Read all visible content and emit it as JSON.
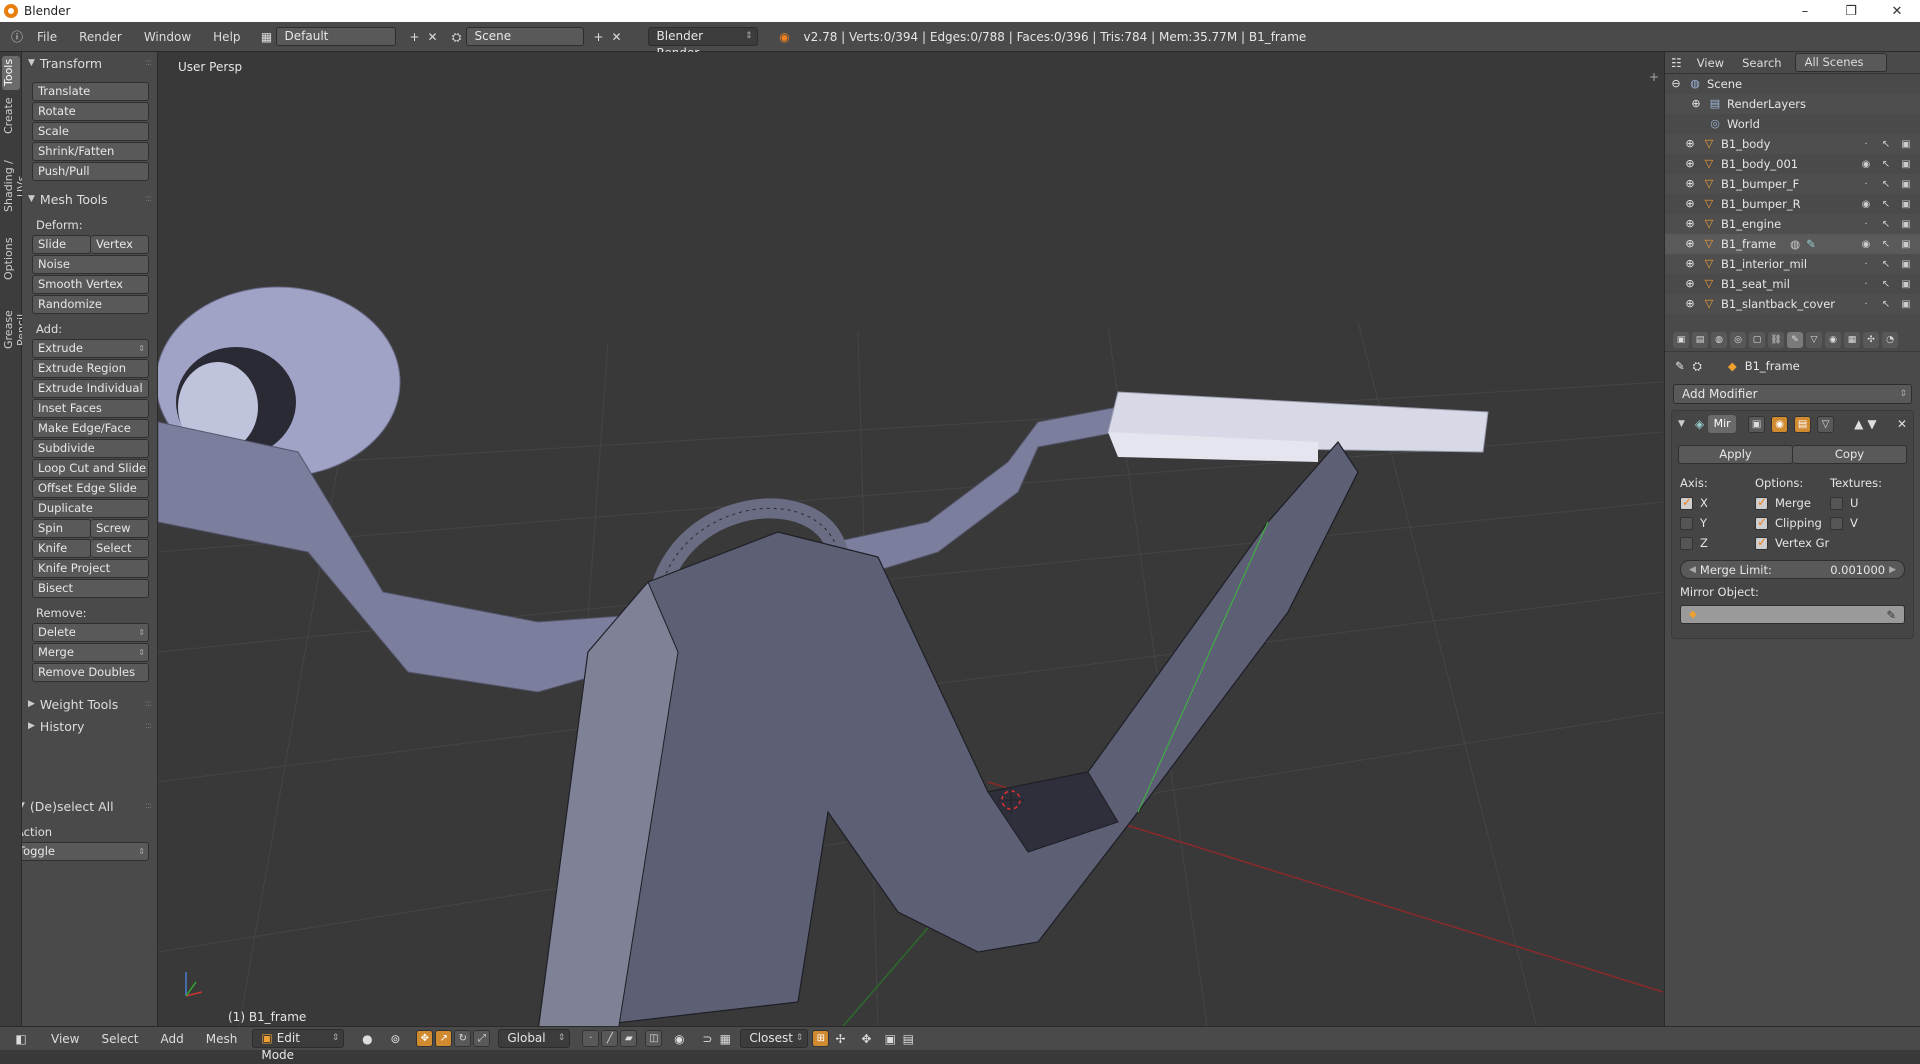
{
  "window": {
    "title": "Blender",
    "controls": [
      "–",
      "❐",
      "✕"
    ]
  },
  "infobar": {
    "menus": [
      "File",
      "Render",
      "Window",
      "Help"
    ],
    "layout": "Default",
    "scene": "Scene",
    "engine": "Blender Render",
    "stats": "v2.78 | Verts:0/394 | Edges:0/788 | Faces:0/396 | Tris:784 | Mem:35.77M | B1_frame"
  },
  "tabs": [
    "Tools",
    "Create",
    "Shading / UVs",
    "Options",
    "Grease Pencil"
  ],
  "toolshelf": {
    "transform": {
      "title": "Transform",
      "buttons": [
        "Translate",
        "Rotate",
        "Scale",
        "Shrink/Fatten",
        "Push/Pull"
      ]
    },
    "mesh_tools": {
      "title": "Mesh Tools",
      "deform_label": "Deform:",
      "slide_edge": "Slide Edge",
      "vertex": "Vertex",
      "deform": [
        "Noise",
        "Smooth Vertex",
        "Randomize"
      ],
      "add_label": "Add:",
      "extrude": "Extrude",
      "add": [
        "Extrude Region",
        "Extrude Individual",
        "Inset Faces",
        "Make Edge/Face",
        "Subdivide",
        "Loop Cut and Slide",
        "Offset Edge Slide",
        "Duplicate"
      ],
      "spin": "Spin",
      "screw": "Screw",
      "knife": "Knife",
      "select": "Select",
      "knife_project": "Knife Project",
      "bisect": "Bisect",
      "remove_label": "Remove:",
      "delete": "Delete",
      "merge": "Merge",
      "remove_doubles": "Remove Doubles"
    },
    "weight_tools": "Weight Tools",
    "history": "History",
    "deselect_all": "(De)select All",
    "action_label": "Action",
    "action_value": "Toggle"
  },
  "viewport": {
    "label": "User Persp",
    "object": "(1) B1_frame"
  },
  "outliner": {
    "header": {
      "view": "View",
      "search": "Search",
      "filter": "All Scenes"
    },
    "scene": "Scene",
    "renderlayers": "RenderLayers",
    "world": "World",
    "objects": [
      "B1_body",
      "B1_body_001",
      "B1_bumper_F",
      "B1_bumper_R",
      "B1_engine",
      "B1_frame",
      "B1_interior_mil",
      "B1_seat_mil",
      "B1_slantback_cover"
    ]
  },
  "properties": {
    "context_object": "B1_frame",
    "add_modifier": "Add Modifier",
    "modifier_name": "Mir",
    "apply": "Apply",
    "copy": "Copy",
    "axis_label": "Axis:",
    "options_label": "Options:",
    "textures_label": "Textures:",
    "axis": [
      "X",
      "Y",
      "Z"
    ],
    "options": [
      "Merge",
      "Clipping",
      "Vertex Gr"
    ],
    "textures": [
      "U",
      "V"
    ],
    "merge_limit_label": "Merge Limit:",
    "merge_limit_value": "0.001000",
    "mirror_object_label": "Mirror Object:"
  },
  "bottombar": {
    "menus": [
      "View",
      "Select",
      "Add",
      "Mesh"
    ],
    "mode": "Edit Mode",
    "orientation": "Global",
    "snap": "Closest"
  }
}
